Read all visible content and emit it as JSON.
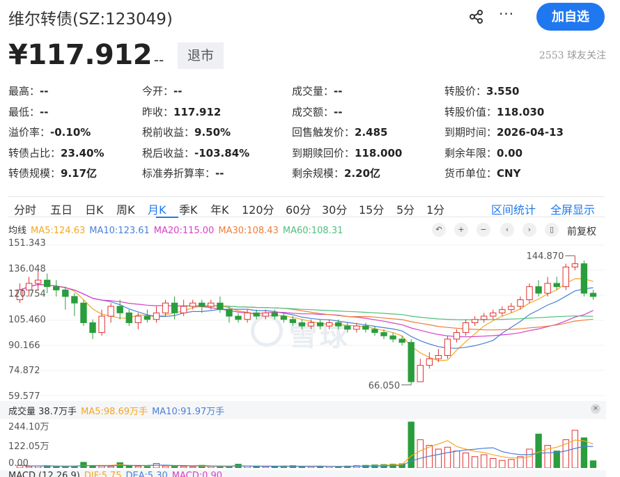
{
  "header": {
    "title": "维尔转债(SZ:123049)",
    "share_icon": "share-icon",
    "more_icon": "more-icon",
    "follow_label": "加自选"
  },
  "quote": {
    "price": "¥117.912",
    "change": "-- --",
    "status": "退市",
    "followers": "2553 球友关注"
  },
  "stats": [
    [
      {
        "k": "最高：",
        "v": "--"
      },
      {
        "k": "今开：",
        "v": "--"
      },
      {
        "k": "成交量：",
        "v": "--"
      },
      {
        "k": "转股价：",
        "v": "3.550"
      }
    ],
    [
      {
        "k": "最低：",
        "v": "--"
      },
      {
        "k": "昨收：",
        "v": "117.912"
      },
      {
        "k": "成交额：",
        "v": "--"
      },
      {
        "k": "转股价值：",
        "v": "118.030"
      }
    ],
    [
      {
        "k": "溢价率：",
        "v": "-0.10%"
      },
      {
        "k": "税前收益：",
        "v": "9.50%"
      },
      {
        "k": "回售触发价：",
        "v": "2.485"
      },
      {
        "k": "到期时间：",
        "v": "2026-04-13"
      }
    ],
    [
      {
        "k": "转债占比：",
        "v": "23.40%"
      },
      {
        "k": "税后收益：",
        "v": "-103.84%"
      },
      {
        "k": "到期赎回价：",
        "v": "118.000"
      },
      {
        "k": "剩余年限：",
        "v": "0.00"
      }
    ],
    [
      {
        "k": "转债规模：",
        "v": "9.17亿"
      },
      {
        "k": "标准券折算率：",
        "v": "--"
      },
      {
        "k": "剩余规模：",
        "v": "2.20亿"
      },
      {
        "k": "货币单位：",
        "v": "CNY"
      }
    ]
  ],
  "tabs": [
    "分时",
    "五日",
    "日K",
    "周K",
    "月K",
    "季K",
    "年K",
    "120分",
    "60分",
    "30分",
    "15分",
    "5分",
    "1分"
  ],
  "active_tab": "月K",
  "tab_actions": [
    "区间统计",
    "全屏显示"
  ],
  "ma_legend": {
    "label": "均线",
    "items": [
      {
        "text": "MA5:124.63",
        "color": "#f5a623"
      },
      {
        "text": "MA10:123.61",
        "color": "#4a7fd9"
      },
      {
        "text": "MA20:115.00",
        "color": "#d63fc7"
      },
      {
        "text": "MA30:108.43",
        "color": "#f07d3a"
      },
      {
        "text": "MA60:108.31",
        "color": "#4fbf7a"
      }
    ]
  },
  "restore_label": "前复权",
  "watermark": "雪球",
  "y_axis": [
    "151.343",
    "136.048",
    "120.754",
    "105.460",
    "90.166",
    "74.872",
    "59.577"
  ],
  "vol_legend": {
    "label": "成交量 38.7万手",
    "items": [
      {
        "text": "MA5:98.69万手",
        "color": "#f5a623"
      },
      {
        "text": "MA10:91.97万手",
        "color": "#4a7fd9"
      }
    ]
  },
  "vol_axis": [
    "244.10万",
    "122.05万",
    "0.00"
  ],
  "macd_legend": {
    "label": "MACD (12,26,9)",
    "items": [
      {
        "text": "DIF:5.75",
        "color": "#f5a623"
      },
      {
        "text": "DEA:5.30",
        "color": "#4a7fd9"
      },
      {
        "text": "MACD:0.90",
        "color": "#d63fc7"
      }
    ]
  },
  "chart_data": {
    "type": "candlestick",
    "ylim": [
      59.577,
      151.343
    ],
    "annotations": [
      {
        "text": "144.870",
        "value": 144.87,
        "index": 61
      },
      {
        "text": "66.050",
        "value": 66.05,
        "index": 43
      }
    ],
    "candles": [
      [
        118,
        124,
        128,
        116
      ],
      [
        124,
        128,
        132,
        120
      ],
      [
        128,
        130,
        136,
        124
      ],
      [
        130,
        126,
        134,
        122
      ],
      [
        126,
        124,
        130,
        120
      ],
      [
        124,
        120,
        126,
        112
      ],
      [
        120,
        116,
        122,
        108
      ],
      [
        116,
        104,
        118,
        102
      ],
      [
        104,
        98,
        106,
        94
      ],
      [
        98,
        108,
        112,
        96
      ],
      [
        108,
        114,
        116,
        104
      ],
      [
        114,
        110,
        118,
        106
      ],
      [
        110,
        104,
        112,
        102
      ],
      [
        104,
        108,
        110,
        100
      ],
      [
        108,
        106,
        112,
        104
      ],
      [
        106,
        110,
        114,
        104
      ],
      [
        110,
        116,
        118,
        108
      ],
      [
        116,
        110,
        120,
        106
      ],
      [
        110,
        114,
        118,
        108
      ],
      [
        114,
        116,
        118,
        112
      ],
      [
        116,
        114,
        118,
        110
      ],
      [
        114,
        116,
        118,
        112
      ],
      [
        116,
        112,
        120,
        110
      ],
      [
        112,
        108,
        114,
        104
      ],
      [
        108,
        106,
        110,
        104
      ],
      [
        106,
        110,
        112,
        104
      ],
      [
        110,
        108,
        112,
        106
      ],
      [
        108,
        110,
        112,
        106
      ],
      [
        110,
        108,
        112,
        106
      ],
      [
        108,
        106,
        110,
        104
      ],
      [
        106,
        104,
        108,
        102
      ],
      [
        104,
        102,
        106,
        100
      ],
      [
        102,
        104,
        106,
        100
      ],
      [
        104,
        102,
        106,
        100
      ],
      [
        102,
        104,
        106,
        100
      ],
      [
        104,
        102,
        106,
        100
      ],
      [
        102,
        100,
        104,
        98
      ],
      [
        100,
        102,
        104,
        98
      ],
      [
        102,
        100,
        104,
        98
      ],
      [
        100,
        98,
        102,
        96
      ],
      [
        98,
        96,
        100,
        94
      ],
      [
        96,
        94,
        98,
        92
      ],
      [
        94,
        92,
        96,
        90
      ],
      [
        92,
        68,
        94,
        66
      ],
      [
        68,
        78,
        82,
        68
      ],
      [
        78,
        82,
        86,
        76
      ],
      [
        82,
        84,
        88,
        80
      ],
      [
        84,
        94,
        96,
        82
      ],
      [
        94,
        98,
        100,
        92
      ],
      [
        98,
        104,
        106,
        96
      ],
      [
        104,
        106,
        108,
        102
      ],
      [
        106,
        108,
        110,
        104
      ],
      [
        108,
        110,
        112,
        106
      ],
      [
        110,
        112,
        114,
        108
      ],
      [
        112,
        114,
        116,
        110
      ],
      [
        114,
        118,
        120,
        112
      ],
      [
        118,
        126,
        128,
        116
      ],
      [
        126,
        122,
        130,
        120
      ],
      [
        122,
        128,
        132,
        120
      ],
      [
        128,
        126,
        132,
        124
      ],
      [
        126,
        138,
        140,
        124
      ],
      [
        138,
        140,
        144.87,
        136
      ],
      [
        140,
        122,
        142,
        120
      ],
      [
        122,
        120,
        124,
        118
      ]
    ],
    "volumes": [
      14,
      8,
      10,
      12,
      6,
      9,
      8,
      30,
      12,
      10,
      8,
      28,
      10,
      9,
      8,
      24,
      10,
      9,
      8,
      6,
      14,
      8,
      7,
      6,
      20,
      9,
      8,
      7,
      6,
      10,
      12,
      8,
      7,
      9,
      8,
      7,
      10,
      12,
      14,
      16,
      18,
      20,
      22,
      244,
      150,
      120,
      100,
      110,
      90,
      80,
      60,
      70,
      50,
      40,
      45,
      60,
      100,
      180,
      120,
      90,
      150,
      200,
      160,
      38
    ],
    "vol_ylim": [
      0,
      244.1
    ]
  }
}
